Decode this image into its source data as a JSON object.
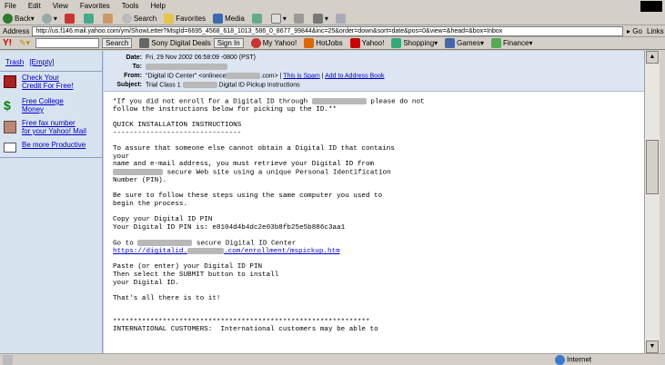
{
  "menu": [
    "File",
    "Edit",
    "View",
    "Favorites",
    "Tools",
    "Help"
  ],
  "toolbar": {
    "back": "Back",
    "search": "Search",
    "favorites": "Favorites",
    "media": "Media"
  },
  "address": {
    "label": "Address",
    "url": "http://us.f146.mail.yahoo.com/ym/ShowLetter?MsgId=6695_4568_618_1013_586_0_8677_99844&inc=25&order=down&sort=date&pos=0&view=&head=&box=Inbox",
    "go": "Go",
    "links": "Links"
  },
  "ybar": {
    "search_btn": "Search",
    "deals": "Sony Digital Deals",
    "signin": "Sign In",
    "myyahoo": "My Yahoo!",
    "hotjobs": "HotJobs",
    "yahoo": "Yahoo!",
    "shopping": "Shopping",
    "games": "Games",
    "finance": "Finance"
  },
  "sidebar": {
    "trash": "Trash",
    "empty": "[Empty]",
    "items": [
      {
        "l1": "Check Your",
        "l2": "Credit For Free!"
      },
      {
        "l1": "Free College",
        "l2": "Money"
      },
      {
        "l1": "Free fax number",
        "l2": "for your Yahoo! Mail"
      },
      {
        "l1": "Be more Productive",
        "l2": ""
      }
    ]
  },
  "header": {
    "date_label": "Date:",
    "date": "Fri, 29 Nov 2002 06:58:09 -0800 (PST)",
    "to_label": "To:",
    "from_label": "From:",
    "from": "\"Digital ID Center\" <onlinece",
    ".com>": "",
    "from_tail": ".com>",
    "spam": "This is Spam",
    "addbook": "Add to Address Book",
    "subject_label": "Subject:",
    "subject_a": "Trial Class 1",
    "subject_b": "Digital ID Pickup Instructions"
  },
  "body": {
    "l1": "*If you did not enroll for a Digital ID through",
    "l1b": "please do not",
    "l2": "follow the instructions below for picking up the ID.**",
    "l4": "QUICK INSTALLATION INSTRUCTIONS",
    "l5": "-------------------------------",
    "l7": "To assure that someone else cannot obtain a Digital ID that contains",
    "l8": "your",
    "l9": "name and e-mail address, you must retrieve your Digital ID from",
    "l10b": "secure Web site using a unique Personal Identification",
    "l11": "Number (PIN).",
    "l13": "Be sure to follow these steps using the same computer you used to",
    "l14": "begin the process.",
    "l16": "Copy your Digital ID PIN",
    "l17": "Your Digital ID PIN is: e8104d4b4dc2e03b8fb25e5b886c3aa1",
    "l19": "Go to",
    "l19b": "secure Digital ID Center",
    "l20a": "https://digitalid.",
    "l20b": ".com/enrollment/mspickup.htm",
    "l22": "Paste (or enter) your Digital ID PIN",
    "l23": "Then select the SUBMIT button to install",
    "l24": "your Digital ID.",
    "l26": "That's all there is to it!",
    "l29": "**************************************************************",
    "l30": "INTERNATIONAL CUSTOMERS:  International customers may be able to"
  },
  "status": {
    "zone": "Internet"
  }
}
